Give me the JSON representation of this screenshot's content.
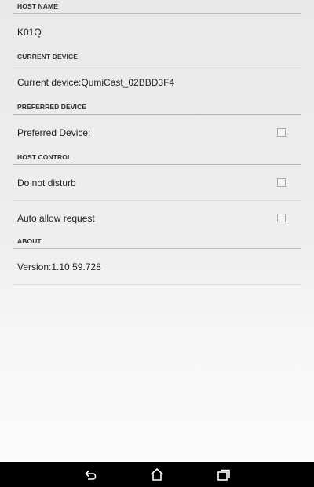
{
  "sections": {
    "host_name": {
      "header": "HOST NAME",
      "value": "K01Q"
    },
    "current_device": {
      "header": "CURRENT DEVICE",
      "value": "Current device:QumiCast_02BBD3F4"
    },
    "preferred_device": {
      "header": "PREFERRED DEVICE",
      "label": "Preferred Device:",
      "checked": false
    },
    "host_control": {
      "header": "HOST CONTROL",
      "items": [
        {
          "label": "Do not disturb",
          "checked": false
        },
        {
          "label": "Auto allow request",
          "checked": false
        }
      ]
    },
    "about": {
      "header": "ABOUT",
      "version": "Version:1.10.59.728"
    }
  },
  "navbar": {
    "icons": [
      "back-icon",
      "home-icon",
      "recent-apps-icon"
    ]
  },
  "colors": {
    "background": "#eeeeee",
    "navbar": "#000000",
    "divider": "#b9b9b9"
  }
}
